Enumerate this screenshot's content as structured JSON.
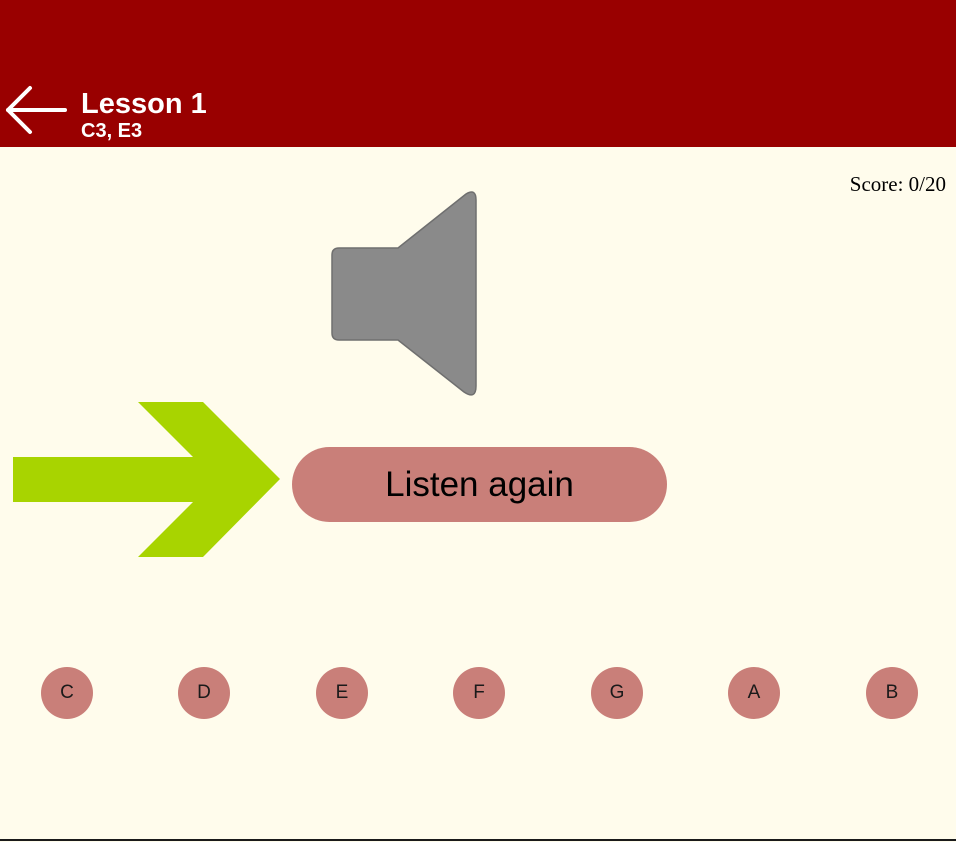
{
  "header": {
    "title": "Lesson 1",
    "subtitle": "C3, E3"
  },
  "score": {
    "text": "Score: 0/20"
  },
  "listen": {
    "label": "Listen again"
  },
  "notes": [
    "C",
    "D",
    "E",
    "F",
    "G",
    "A",
    "B"
  ],
  "colors": {
    "header_bg": "#990000",
    "page_bg": "#fffcec",
    "button_bg": "#c97f79",
    "arrow": "#a8d400",
    "speaker": "#8a8a8a"
  },
  "icons": {
    "back": "back-arrow-icon",
    "speaker": "speaker-icon",
    "pointer": "right-arrow-icon"
  }
}
